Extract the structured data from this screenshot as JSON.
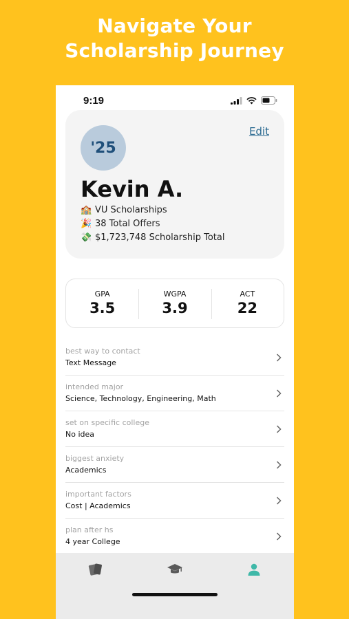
{
  "headline": {
    "line1": "Navigate Your",
    "line2": "Scholarship Journey"
  },
  "status_bar": {
    "time": "9:19"
  },
  "profile": {
    "class_year": "'25",
    "edit_label": "Edit",
    "name": "Kevin A.",
    "stats": [
      {
        "icon": "school-building-icon",
        "emoji": "🏫",
        "text": "VU Scholarships"
      },
      {
        "icon": "party-popper-icon",
        "emoji": "🎉",
        "text": "38 Total Offers"
      },
      {
        "icon": "money-icon",
        "emoji": "💸",
        "text": "$1,723,748 Scholarship Total"
      }
    ]
  },
  "metrics": [
    {
      "label": "GPA",
      "value": "3.5"
    },
    {
      "label": "WGPA",
      "value": "3.9"
    },
    {
      "label": "ACT",
      "value": "22"
    }
  ],
  "details": [
    {
      "label": "best way to contact",
      "value": "Text Message"
    },
    {
      "label": "intended major",
      "value": "Science, Technology, Engineering, Math"
    },
    {
      "label": "set on specific college",
      "value": "No idea"
    },
    {
      "label": "biggest anxiety",
      "value": "Academics"
    },
    {
      "label": "important factors",
      "value": "Cost | Academics"
    },
    {
      "label": "plan after hs",
      "value": "4 year College"
    }
  ],
  "tabs": [
    {
      "icon": "cards-icon",
      "active": false
    },
    {
      "icon": "graduation-cap-icon",
      "active": false
    },
    {
      "icon": "profile-icon",
      "active": true
    }
  ],
  "colors": {
    "background": "#ffc21e",
    "accent": "#3fb8a8",
    "link": "#2b6a91"
  }
}
